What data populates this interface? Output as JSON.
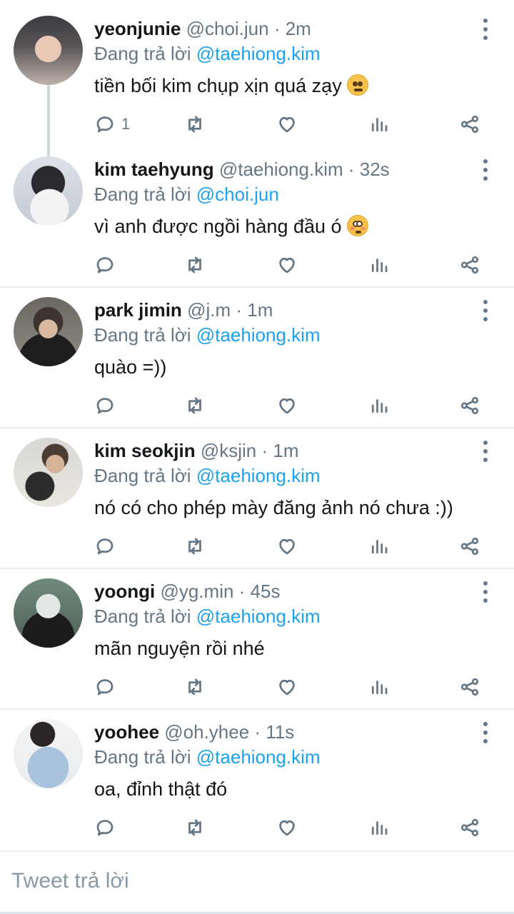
{
  "tweets": [
    {
      "name": "yeonjunie",
      "handle": "@choi.jun",
      "time": "2m",
      "reply_prefix": "Đang trả lời ",
      "reply_to": "@taehiong.kim",
      "text": "tiền bối kim chụp xịn quá zạy",
      "emoji": "confounded-face",
      "reply_count": "1"
    },
    {
      "name": "kim taehyung",
      "handle": "@taehiong.kim",
      "time": "32s",
      "reply_prefix": "Đang trả lời ",
      "reply_to": "@choi.jun",
      "text": "vì anh được ngồi hàng đầu ó",
      "emoji": "flushed-face",
      "reply_count": ""
    },
    {
      "name": "park jimin",
      "handle": "@j.m",
      "time": "1m",
      "reply_prefix": "Đang trả lời ",
      "reply_to": "@taehiong.kim",
      "text": "quào =))",
      "reply_count": ""
    },
    {
      "name": "kim seokjin",
      "handle": "@ksjin",
      "time": "1m",
      "reply_prefix": "Đang trả lời ",
      "reply_to": "@taehiong.kim",
      "text": "nó có cho phép mày đăng ảnh nó chưa :))",
      "reply_count": ""
    },
    {
      "name": "yoongi",
      "handle": "@yg.min",
      "time": "45s",
      "reply_prefix": "Đang trả lời ",
      "reply_to": "@taehiong.kim",
      "text": "mãn nguyện rồi nhé",
      "reply_count": ""
    },
    {
      "name": "yoohee",
      "handle": "@oh.yhee",
      "time": "11s",
      "reply_prefix": "Đang trả lời ",
      "reply_to": "@taehiong.kim",
      "text": "oa, đỉnh thật đó",
      "reply_count": ""
    }
  ],
  "separator": " · ",
  "compose": {
    "placeholder": "Tweet trả lời"
  },
  "colors": {
    "mention": "#1da1f2",
    "meta": "#657786",
    "divider": "#e6ecf0"
  }
}
